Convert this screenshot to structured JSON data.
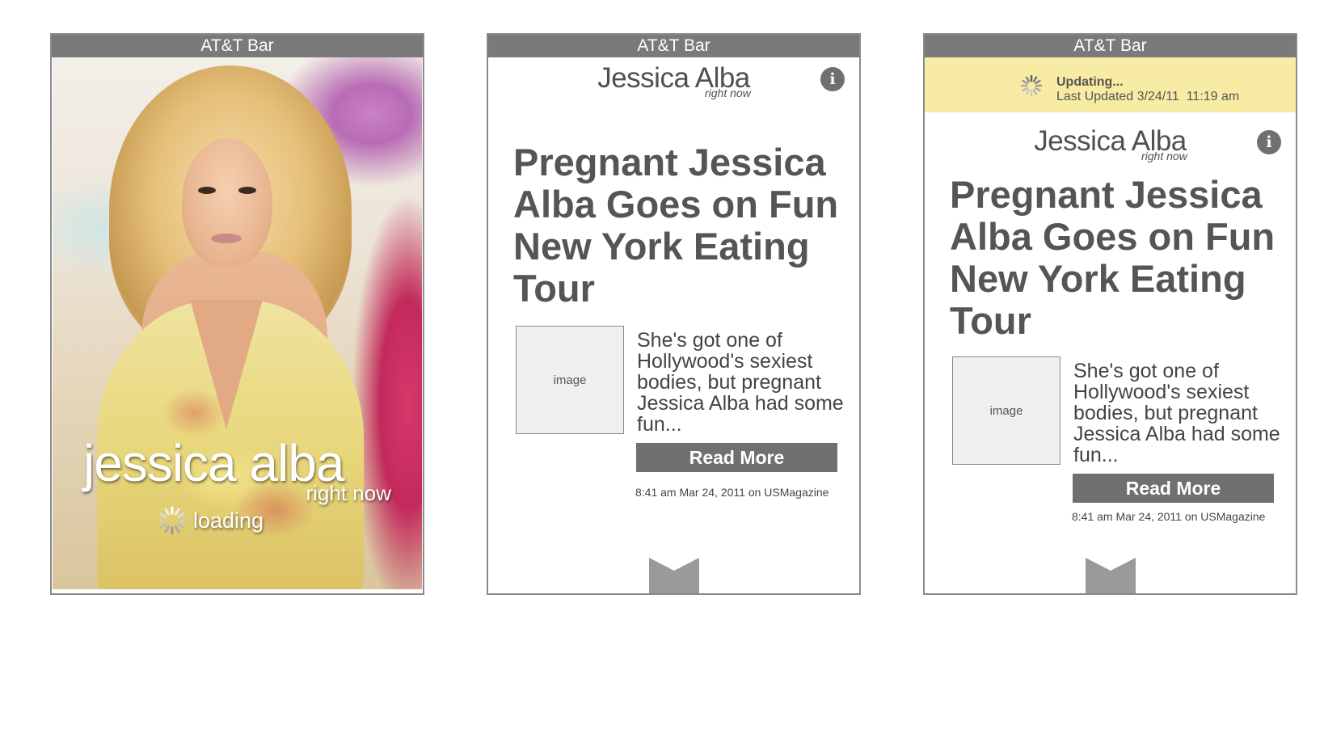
{
  "screens": {
    "splash": {
      "status_bar": "AT&T Bar",
      "title": "jessica alba",
      "subtitle": "right now",
      "loading_text": "loading"
    },
    "article": {
      "status_bar": "AT&T Bar",
      "app_title": "Jessica Alba",
      "app_subtitle": "right now",
      "info_icon": "i",
      "headline": "Pregnant Jessica Alba Goes on Fun New York Eating Tour",
      "image_label": "image",
      "summary": "She's got one of Hollywood's sexiest bodies, but pregnant Jessica Alba had some fun...",
      "read_more": "Read More",
      "meta": "8:41 am Mar 24, 2011 on USMagazine"
    },
    "article_updating": {
      "status_bar": "AT&T Bar",
      "update_title": "Updating...",
      "update_time": "Last Updated 3/24/11  11:19 am",
      "app_title": "Jessica Alba",
      "app_subtitle": "right now",
      "info_icon": "i",
      "headline": "Pregnant Jessica Alba Goes on Fun New York Eating Tour",
      "image_label": "image",
      "summary": "She's got one of Hollywood's sexiest bodies, but pregnant Jessica Alba had some fun...",
      "read_more": "Read More",
      "meta": "8:41 am Mar 24, 2011 on USMagazine"
    }
  },
  "icons": {
    "info": "info-icon",
    "spinner": "spinner-icon",
    "bottom_tab": "bottom-tab-icon"
  },
  "colors": {
    "status_bar": "#7a7a7a",
    "button": "#707070",
    "banner": "#f8eca4",
    "headline": "#555555"
  }
}
